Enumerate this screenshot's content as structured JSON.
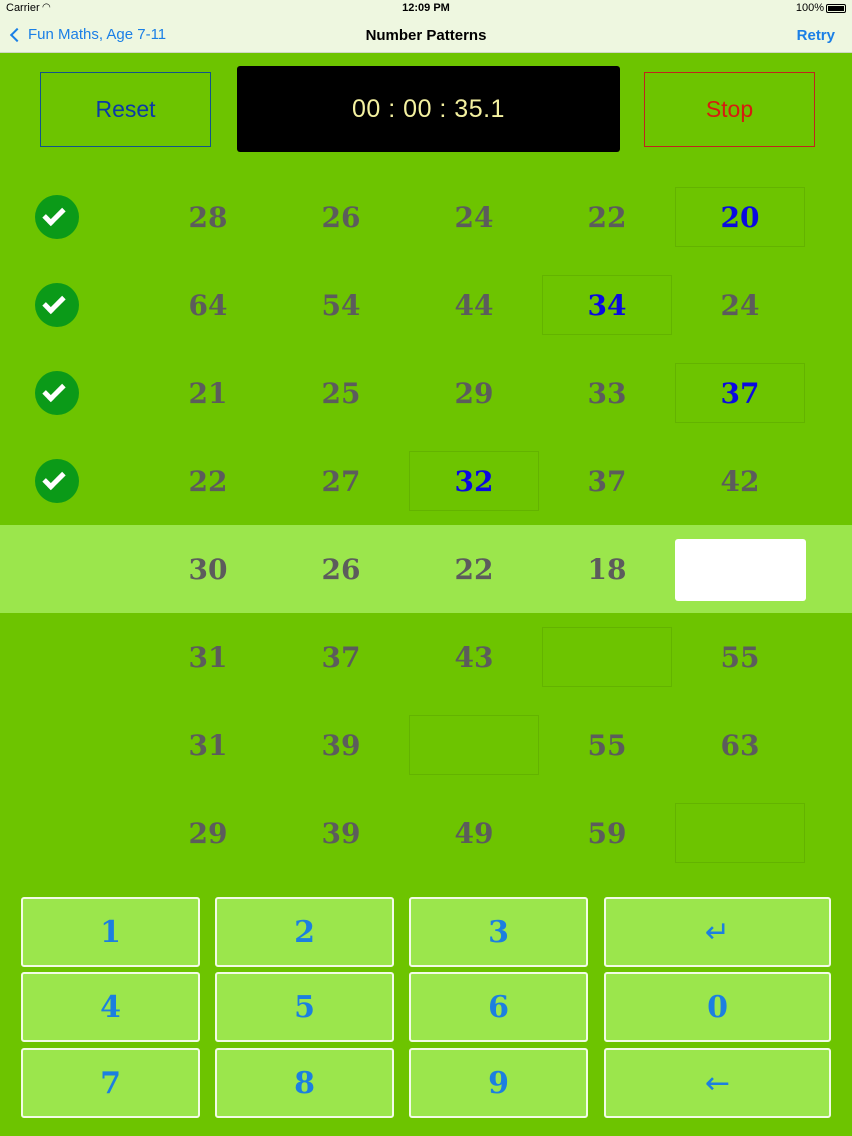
{
  "status_bar": {
    "carrier": "Carrier",
    "time": "12:09 PM",
    "battery": "100%"
  },
  "nav": {
    "back_label": "Fun Maths, Age 7-11",
    "title": "Number Patterns",
    "retry_label": "Retry"
  },
  "controls": {
    "reset_label": "Reset",
    "timer": "00 : 00 : 35.1",
    "stop_label": "Stop"
  },
  "rows": [
    {
      "checked": true,
      "cells": [
        "28",
        "26",
        "24",
        "22",
        "20"
      ]
    },
    {
      "checked": true,
      "cells": [
        "64",
        "54",
        "44",
        "34",
        "24"
      ]
    },
    {
      "checked": true,
      "cells": [
        "21",
        "25",
        "29",
        "33",
        "37"
      ]
    },
    {
      "checked": true,
      "cells": [
        "22",
        "27",
        "32",
        "37",
        "42"
      ]
    },
    {
      "checked": false,
      "cells": [
        "30",
        "26",
        "22",
        "18",
        ""
      ]
    },
    {
      "checked": false,
      "cells": [
        "31",
        "37",
        "43",
        "",
        "55"
      ]
    },
    {
      "checked": false,
      "cells": [
        "31",
        "39",
        "",
        "55",
        "63"
      ]
    },
    {
      "checked": false,
      "cells": [
        "29",
        "39",
        "49",
        "59",
        ""
      ]
    }
  ],
  "keypad": {
    "k1": "1",
    "k2": "2",
    "k3": "3",
    "enter": "↵",
    "k4": "4",
    "k5": "5",
    "k6": "6",
    "k0": "0",
    "k7": "7",
    "k8": "8",
    "k9": "9",
    "backspace": "←"
  }
}
